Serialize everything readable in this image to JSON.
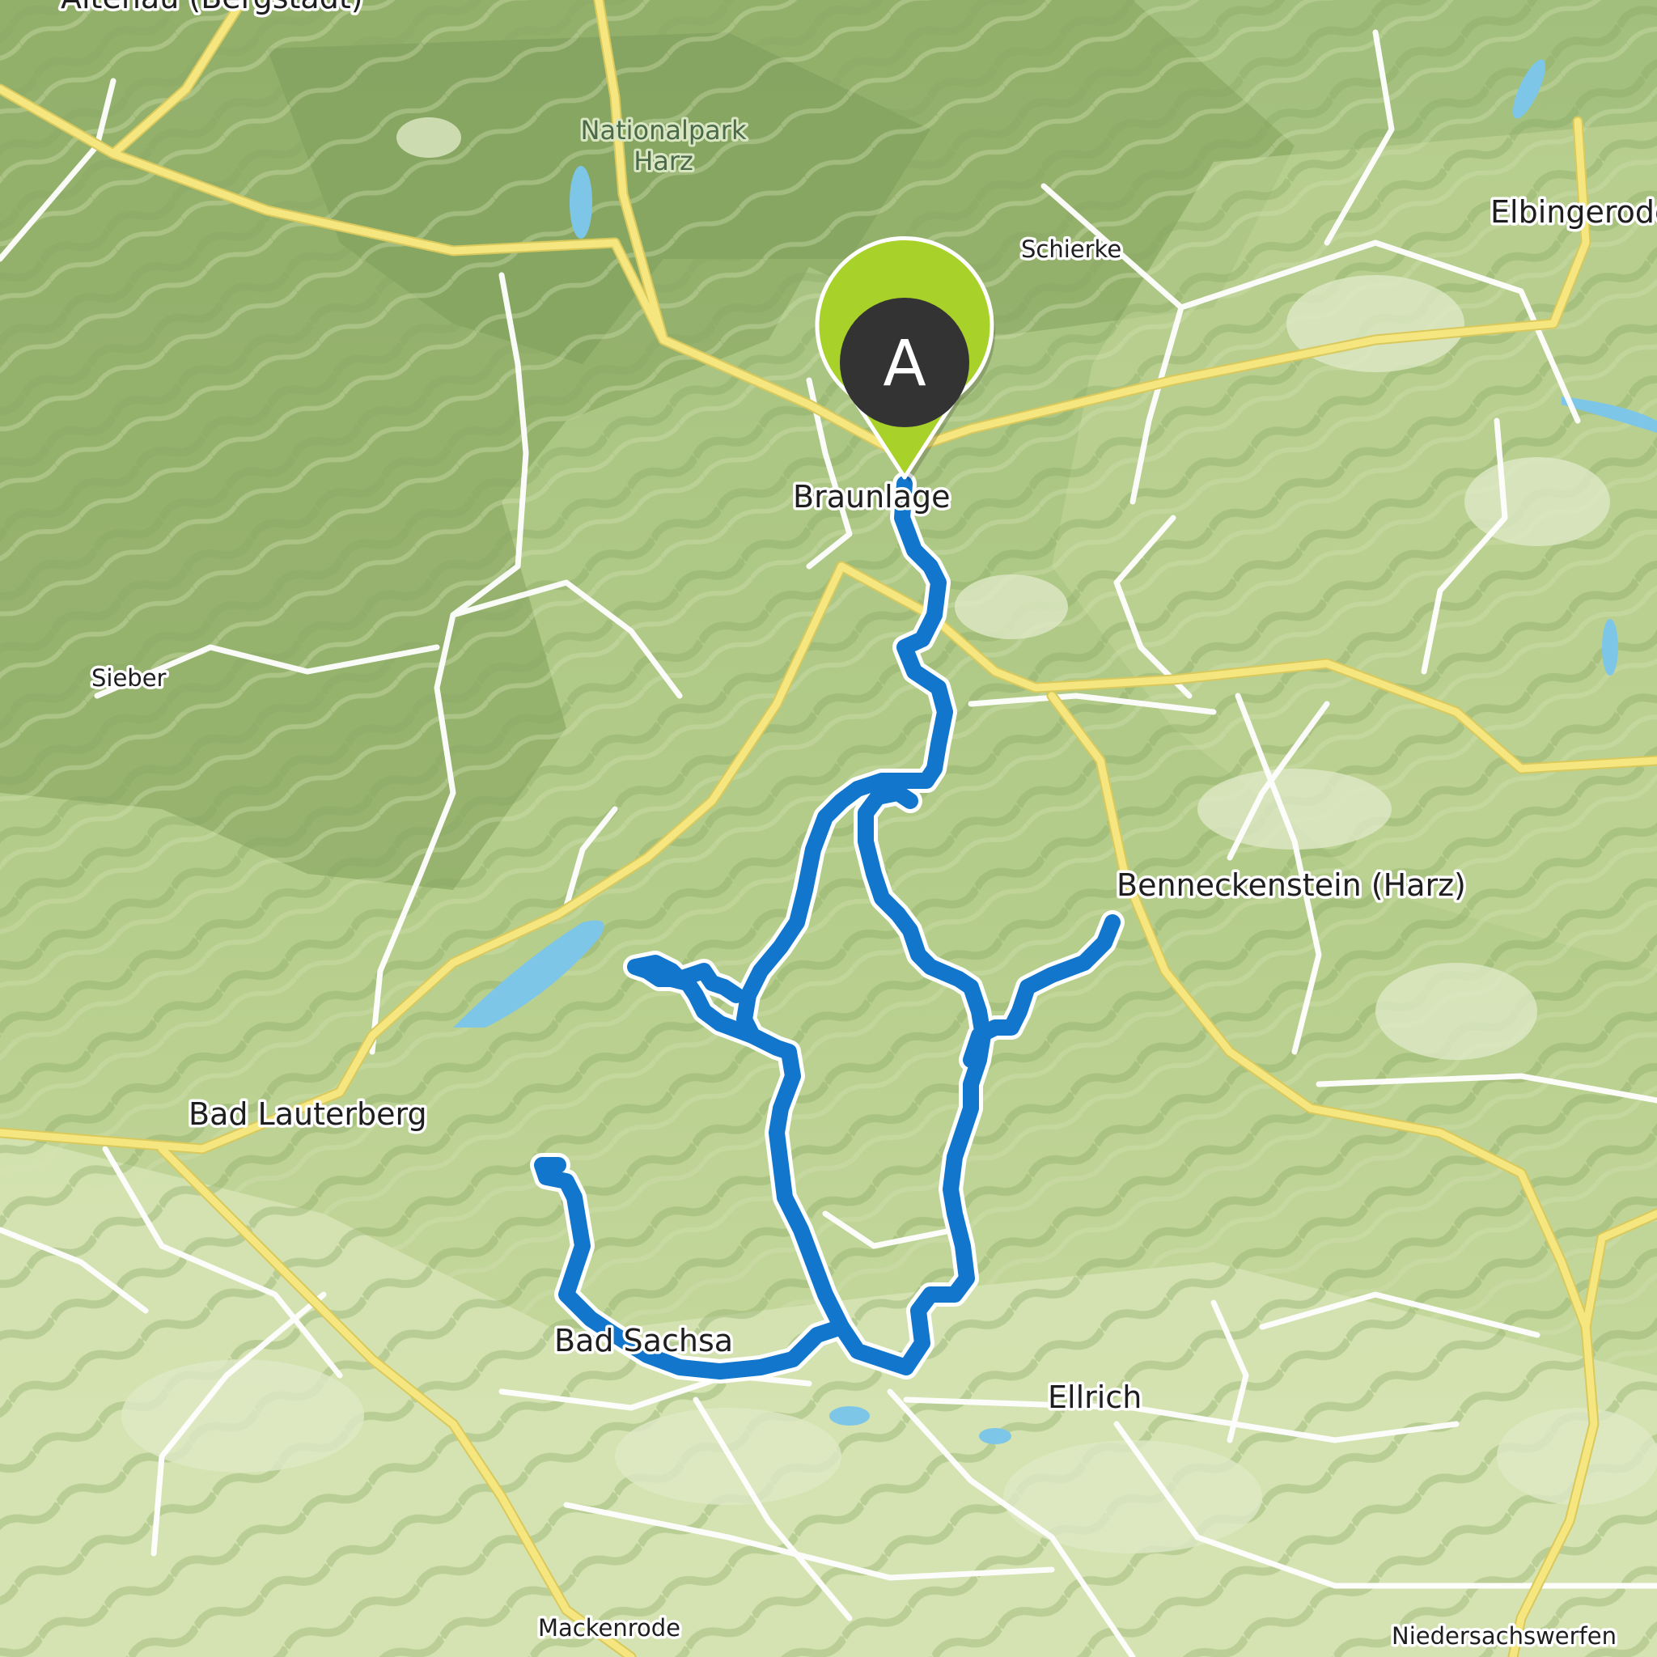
{
  "map": {
    "labels": {
      "altenau": "Altenau (Bergstadt)",
      "nationalpark_1": "Nationalpark",
      "nationalpark_2": "Harz",
      "schierke": "Schierke",
      "elbingerode": "Elbingerode",
      "braunlage": "Braunlage",
      "sieber": "Sieber",
      "benneckenstein": "Benneckenstein (Harz)",
      "bad_lauterberg": "Bad Lauterberg",
      "bad_sachsa": "Bad Sachsa",
      "ellrich": "Ellrich",
      "mackenrode": "Mackenrode",
      "niedersachswerfen": "Niedersachswerfen"
    },
    "start_marker": {
      "letter": "A"
    },
    "colors": {
      "route": "#1277cc",
      "terrain_light": "#c9dc9c",
      "terrain_dark": "#8fae68",
      "forest": "#a9c485",
      "main_road": "#f3e27a",
      "minor_road": "#ffffff",
      "water": "#7ec6e8",
      "marker_ring": "#a8d12a",
      "marker_fill": "#333333"
    }
  }
}
